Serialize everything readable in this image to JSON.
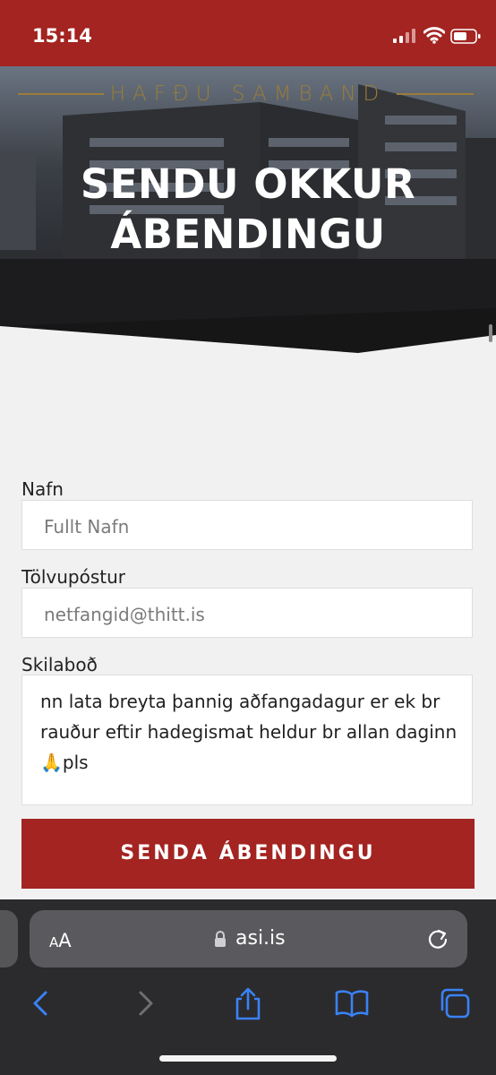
{
  "status": {
    "time": "15:14"
  },
  "hero": {
    "eyebrow": "HAFÐU SAMBAND",
    "title_line1": "SENDU OKKUR",
    "title_line2": "ÁBENDINGU"
  },
  "form": {
    "name": {
      "label": "Nafn",
      "placeholder": "Fullt Nafn"
    },
    "email": {
      "label": "Tölvupóstur",
      "placeholder": "netfangid@thitt.is"
    },
    "message": {
      "label": "Skilaboð",
      "value_line1": "nn lata breyta þannig aðfangadagur er ek br",
      "value_line2": "rauður eftir hadegismat heldur br allan daginn",
      "value_line3_emoji": "🙏",
      "value_line3": "pls"
    },
    "submit_label": "SENDA ÁBENDINGU"
  },
  "browser": {
    "text_size_small": "A",
    "text_size_big": "A",
    "url": "asi.is",
    "icons": [
      "lock-icon",
      "reload-icon",
      "back-icon",
      "forward-icon",
      "share-icon",
      "bookmarks-icon",
      "tabs-icon"
    ]
  },
  "colors": {
    "brand_red": "#a32421",
    "gold": "#9a7d3a",
    "page_bg": "#f1f1f1",
    "safari_bg": "#2b2b2d",
    "ios_blue": "#3a82f6"
  }
}
